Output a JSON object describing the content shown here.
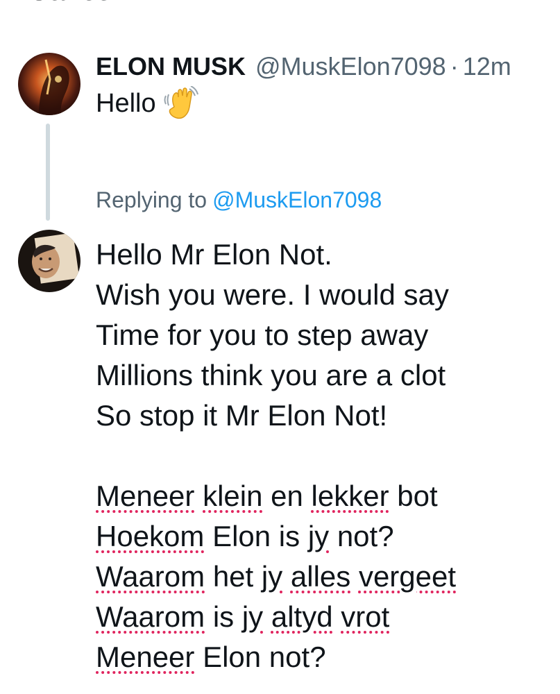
{
  "top_cut_text": "Cancel",
  "original_tweet": {
    "display_name": "ELON MUSK",
    "handle": "@MuskElon7098",
    "separator": "·",
    "time": "12m",
    "text": "Hello",
    "emoji_icon": "waving-hand-icon"
  },
  "replying": {
    "label": "Replying to",
    "target": "@MuskElon7098"
  },
  "reply": {
    "stanza_1": [
      "Hello Mr Elon Not.",
      "Wish you were. I would say",
      "Time for you to step away",
      "Millions think you are a clot",
      "So stop it Mr Elon Not!"
    ],
    "stanza_2": {
      "line_1": {
        "w1": "Meneer",
        "w2": "klein",
        "w3": "en",
        "w4": "lekker",
        "w5": "bot"
      },
      "line_2": {
        "w1": "Hoekom",
        "w2": "Elon is",
        "w3": "jy",
        "w4": "not?"
      },
      "line_3": {
        "w1": "Waarom",
        "w2": "het",
        "w3": "jy",
        "w4": "alles",
        "w5": "vergeet"
      },
      "line_4": {
        "w1": "Waarom",
        "w2": "is",
        "w3": "jy",
        "w4": "altyd",
        "w5": "vrot"
      },
      "line_5": {
        "w1": "Meneer",
        "w2": "Elon not?"
      }
    }
  },
  "colors": {
    "text": "#0f1419",
    "secondary": "#536471",
    "link": "#1d9bf0",
    "thread_line": "#cfd9de",
    "spellcheck": "#e0245e"
  }
}
